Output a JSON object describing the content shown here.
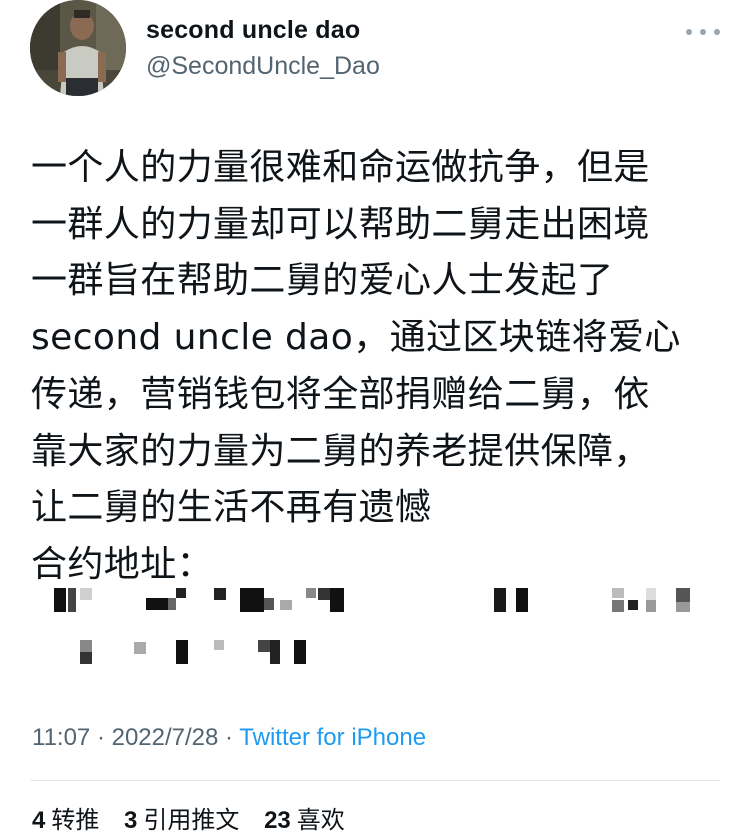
{
  "author": {
    "display_name": "second uncle dao",
    "handle": "@SecondUncle_Dao",
    "avatar_icon": "avatar-photo"
  },
  "more_icon": "more-horizontal-icon",
  "tweet": {
    "lines": [
      "一个人的力量很难和命运做抗争，但是",
      "一群人的力量却可以帮助二舅走出困境",
      "一群旨在帮助二舅的爱心人士发起了",
      "second uncle dao，通过区块链将爱心",
      "传递，营销钱包将全部捐赠给二舅，依",
      "靠大家的力量为二舅的养老提供保障，",
      "让二舅的生活不再有遗憾",
      "合约地址："
    ],
    "redacted_address": "pixelated-contract-address"
  },
  "meta": {
    "time": "11:07",
    "separator": " · ",
    "date": "2022/7/28",
    "separator2": " · ",
    "source": "Twitter for iPhone"
  },
  "stats": {
    "retweets_count": "4",
    "retweets_label": "转推",
    "quotes_count": "3",
    "quotes_label": "引用推文",
    "likes_count": "23",
    "likes_label": "喜欢"
  },
  "colors": {
    "text": "#0f1419",
    "secondary": "#536471",
    "link": "#1d9bf0",
    "divider": "#e6e9eb"
  }
}
